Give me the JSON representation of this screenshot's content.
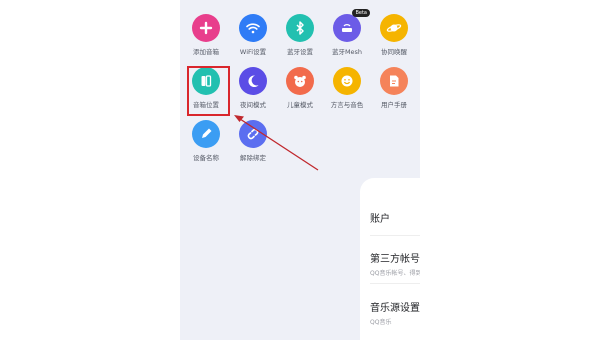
{
  "tiles": [
    {
      "id": "add",
      "label": "添加音箱",
      "color": "#e83e8c",
      "icon": "plus-icon"
    },
    {
      "id": "wifi",
      "label": "WiFi设置",
      "color": "#2f7cf6",
      "icon": "wifi-icon"
    },
    {
      "id": "bt",
      "label": "蓝牙设置",
      "color": "#22c0b0",
      "icon": "bluetooth-icon"
    },
    {
      "id": "mesh",
      "label": "蓝牙Mesh",
      "color": "#6c5ce7",
      "icon": "router-icon",
      "badge": "Beta"
    },
    {
      "id": "sync",
      "label": "协同唤醒",
      "color": "#f5b400",
      "icon": "planet-icon"
    },
    {
      "id": "pos",
      "label": "音箱位置",
      "color": "#22c0b0",
      "icon": "speaker-position-icon"
    },
    {
      "id": "night",
      "label": "夜间模式",
      "color": "#5b4de6",
      "icon": "moon-icon"
    },
    {
      "id": "kids",
      "label": "儿童模式",
      "color": "#f26b4c",
      "icon": "child-face-icon"
    },
    {
      "id": "dialect",
      "label": "方言与音色",
      "color": "#f5b400",
      "icon": "smile-face-icon"
    },
    {
      "id": "manual",
      "label": "用户手册",
      "color": "#f5835a",
      "icon": "document-icon"
    },
    {
      "id": "name",
      "label": "设备名称",
      "color": "#3b9df3",
      "icon": "pencil-icon"
    },
    {
      "id": "unbind",
      "label": "解除绑定",
      "color": "#5b6ef0",
      "icon": "link-broken-icon"
    }
  ],
  "rows": [
    {
      "title": "账户",
      "subtitle": ""
    },
    {
      "title": "第三方帐号管理",
      "subtitle": "QQ音乐帐号、得到帐号、喜马拉雅帐号"
    },
    {
      "title": "音乐源设置",
      "subtitle": "QQ音乐"
    }
  ],
  "colors": {
    "highlight": "#d9262c",
    "arrow": "#c0282d"
  }
}
